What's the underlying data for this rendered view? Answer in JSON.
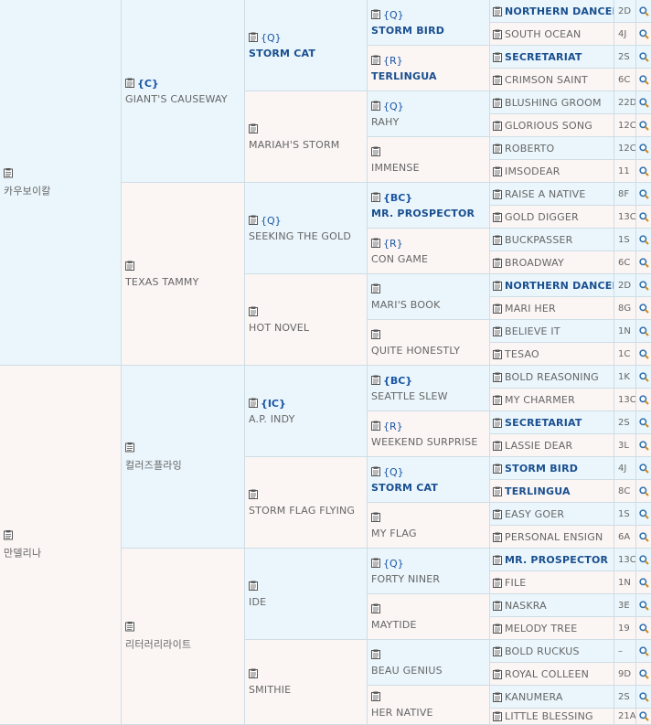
{
  "pedigree": {
    "gen1": [
      {
        "name": "카우보이칼",
        "tag": ""
      },
      {
        "name": "만델리나",
        "tag": ""
      }
    ],
    "gen2": [
      {
        "name": "GIANT'S CAUSEWAY",
        "tag": "{C}"
      },
      {
        "name": "TEXAS TAMMY",
        "tag": ""
      },
      {
        "name": "컬러즈플라잉",
        "tag": ""
      },
      {
        "name": "리터러리라이트",
        "tag": ""
      }
    ],
    "gen3": [
      {
        "name": "STORM CAT",
        "tag": "{Q}",
        "bold": true
      },
      {
        "name": "MARIAH'S STORM",
        "tag": ""
      },
      {
        "name": "SEEKING THE GOLD",
        "tag": "{Q}"
      },
      {
        "name": "HOT NOVEL",
        "tag": ""
      },
      {
        "name": "A.P. INDY",
        "tag": "{IC}"
      },
      {
        "name": "STORM FLAG FLYING",
        "tag": ""
      },
      {
        "name": "IDE",
        "tag": ""
      },
      {
        "name": "SMITHIE",
        "tag": ""
      }
    ],
    "gen4": [
      {
        "name": "STORM BIRD",
        "tag": "{Q}",
        "bold": true
      },
      {
        "name": "TERLINGUA",
        "tag": "{R}",
        "bold": true
      },
      {
        "name": "RAHY",
        "tag": "{Q}"
      },
      {
        "name": "IMMENSE",
        "tag": ""
      },
      {
        "name": "MR. PROSPECTOR",
        "tag": "{BC}",
        "bold": true
      },
      {
        "name": "CON GAME",
        "tag": "{R}"
      },
      {
        "name": "MARI'S BOOK",
        "tag": ""
      },
      {
        "name": "QUITE HONESTLY",
        "tag": ""
      },
      {
        "name": "SEATTLE SLEW",
        "tag": "{BC}"
      },
      {
        "name": "WEEKEND SURPRISE",
        "tag": "{R}"
      },
      {
        "name": "STORM CAT",
        "tag": "{Q}",
        "bold": true
      },
      {
        "name": "MY FLAG",
        "tag": ""
      },
      {
        "name": "FORTY NINER",
        "tag": "{Q}"
      },
      {
        "name": "MAYTIDE",
        "tag": ""
      },
      {
        "name": "BEAU GENIUS",
        "tag": ""
      },
      {
        "name": "HER NATIVE",
        "tag": ""
      }
    ],
    "gen5": [
      {
        "name": "NORTHERN DANCER",
        "code": "2D",
        "bold": true
      },
      {
        "name": "SOUTH OCEAN",
        "code": "4J"
      },
      {
        "name": "SECRETARIAT",
        "code": "2S",
        "bold": true
      },
      {
        "name": "CRIMSON SAINT",
        "code": "6C"
      },
      {
        "name": "BLUSHING GROOM",
        "code": "22D"
      },
      {
        "name": "GLORIOUS SONG",
        "code": "12C"
      },
      {
        "name": "ROBERTO",
        "code": "12C"
      },
      {
        "name": "IMSODEAR",
        "code": "11"
      },
      {
        "name": "RAISE A NATIVE",
        "code": "8F"
      },
      {
        "name": "GOLD DIGGER",
        "code": "13C"
      },
      {
        "name": "BUCKPASSER",
        "code": "1S"
      },
      {
        "name": "BROADWAY",
        "code": "6C"
      },
      {
        "name": "NORTHERN DANCER",
        "code": "2D",
        "bold": true
      },
      {
        "name": "MARI HER",
        "code": "8G"
      },
      {
        "name": "BELIEVE IT",
        "code": "1N"
      },
      {
        "name": "TESAO",
        "code": "1C"
      },
      {
        "name": "BOLD REASONING",
        "code": "1K"
      },
      {
        "name": "MY CHARMER",
        "code": "13C"
      },
      {
        "name": "SECRETARIAT",
        "code": "2S",
        "bold": true
      },
      {
        "name": "LASSIE DEAR",
        "code": "3L"
      },
      {
        "name": "STORM BIRD",
        "code": "4J",
        "bold": true
      },
      {
        "name": "TERLINGUA",
        "code": "8C",
        "bold": true
      },
      {
        "name": "EASY GOER",
        "code": "1S"
      },
      {
        "name": "PERSONAL ENSIGN",
        "code": "6A"
      },
      {
        "name": "MR. PROSPECTOR",
        "code": "13C",
        "bold": true
      },
      {
        "name": "FILE",
        "code": "1N"
      },
      {
        "name": "NASKRA",
        "code": "3E"
      },
      {
        "name": "MELODY TREE",
        "code": "19"
      },
      {
        "name": "BOLD RUCKUS",
        "code": "–"
      },
      {
        "name": "ROYAL COLLEEN",
        "code": "9D"
      },
      {
        "name": "KANUMERA",
        "code": "2S"
      },
      {
        "name": "LITTLE BLESSING",
        "code": "21A"
      }
    ]
  },
  "colors": {
    "blue_bg": "#eaf6fc",
    "pink_bg": "#fbf5f4",
    "tag_blue": "#1a55a4",
    "name_bold": "#1a4f8f",
    "text_grey": "#666666",
    "border": "#cfdde5"
  },
  "icons": {
    "clipboard": "clipboard-icon",
    "search": "search-icon"
  }
}
